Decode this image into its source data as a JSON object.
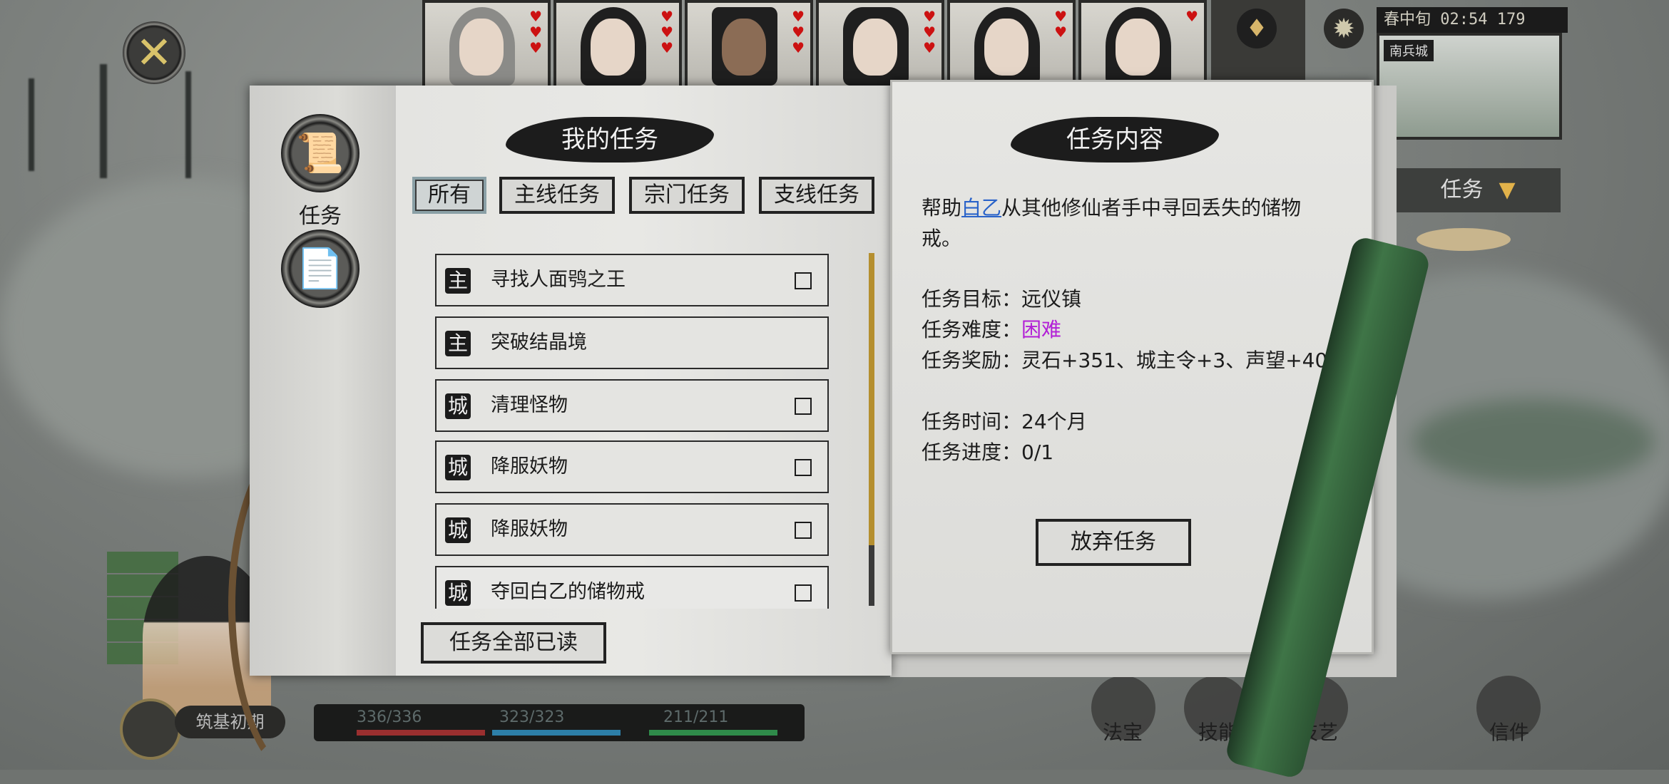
{
  "top_bar": {
    "clock": "春中旬 02:54 179",
    "minimap_label": "南兵城",
    "task_dropdown": "任务"
  },
  "side_menu": {
    "task_label": "任务"
  },
  "left_page": {
    "title": "我的任务",
    "tabs": [
      "所有",
      "主线任务",
      "宗门任务",
      "支线任务"
    ],
    "active_tab": "所有",
    "quests": [
      {
        "badge": "主",
        "title": "寻找人面鸮之王",
        "has_checkbox": true
      },
      {
        "badge": "主",
        "title": "突破结晶境",
        "has_checkbox": false
      },
      {
        "badge": "城",
        "title": "清理怪物",
        "has_checkbox": true
      },
      {
        "badge": "城",
        "title": "降服妖物",
        "has_checkbox": true
      },
      {
        "badge": "城",
        "title": "降服妖物",
        "has_checkbox": true
      },
      {
        "badge": "城",
        "title": "夺回白乙的储物戒",
        "has_checkbox": true
      }
    ],
    "mark_all_read": "任务全部已读"
  },
  "right_page": {
    "title": "任务内容",
    "desc_prefix": "帮助",
    "desc_npc": "白乙",
    "desc_suffix": "从其他修仙者手中寻回丢失的储物戒。",
    "target_label": "任务目标：",
    "target_value": "远仪镇",
    "difficulty_label": "任务难度：",
    "difficulty_value": "困难",
    "reward_label": "任务奖励：",
    "reward_value": "灵石+351、城主令+3、声望+40",
    "time_label": "任务时间：",
    "time_value": "24个月",
    "progress_label": "任务进度：",
    "progress_value": "0/1",
    "abandon_button": "放弃任务"
  },
  "hud": {
    "realm": "筑基初期",
    "hp": "336/336",
    "mp": "323/323",
    "sp": "211/211",
    "bottom_labels": [
      "法宝",
      "技能",
      "技艺",
      "信件"
    ]
  },
  "colors": {
    "difficulty_hard": "#b21fd6",
    "npc_link": "#2a63c9",
    "scroll_thumb": "#b58f2f"
  }
}
